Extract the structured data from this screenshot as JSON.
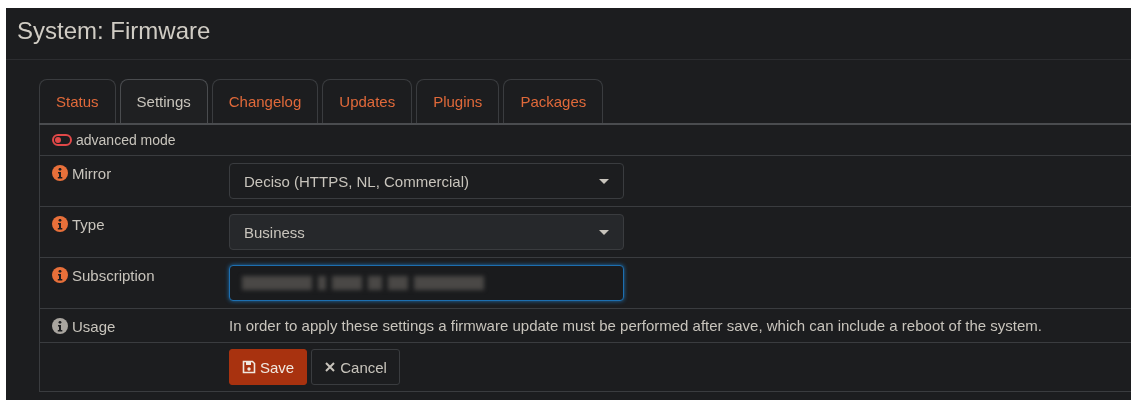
{
  "page_title": "System: Firmware",
  "tabs": [
    {
      "label": "Status",
      "selected": false
    },
    {
      "label": "Settings",
      "selected": true
    },
    {
      "label": "Changelog",
      "selected": false
    },
    {
      "label": "Updates",
      "selected": false
    },
    {
      "label": "Plugins",
      "selected": false
    },
    {
      "label": "Packages",
      "selected": false
    }
  ],
  "advanced_mode": {
    "label": "advanced mode",
    "on": false
  },
  "rows": [
    {
      "kind": "select",
      "label": "Mirror",
      "color": "#e8703a",
      "value": "Deciso (HTTPS, NL, Commercial)"
    },
    {
      "kind": "select",
      "label": "Type",
      "color": "#e8703a",
      "value": "Business"
    },
    {
      "kind": "redacted",
      "label": "Subscription",
      "color": "#e8703a"
    },
    {
      "kind": "text",
      "label": "Usage",
      "color": "#a9a59f",
      "value": "In order to apply these settings a firmware update must be performed after save, which can include a reboot of the system."
    }
  ],
  "buttons": [
    {
      "kind": "save",
      "label": "Save"
    },
    {
      "kind": "cancel",
      "label": "Cancel"
    }
  ]
}
